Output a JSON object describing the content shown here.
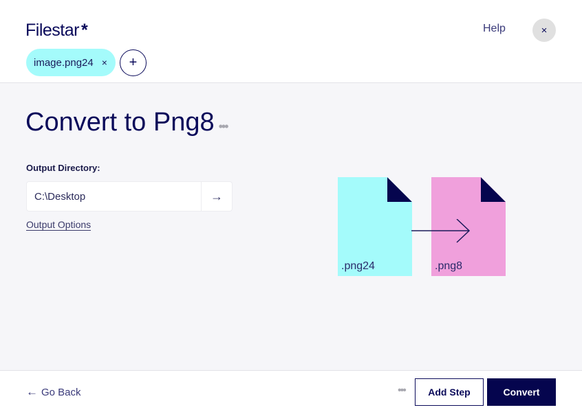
{
  "header": {
    "logo": "Filestar",
    "logo_mark": "*",
    "help_label": "Help",
    "close_icon": "×",
    "file_chip": {
      "label": "image.png24",
      "remove_icon": "×"
    },
    "add_file_icon": "+"
  },
  "main": {
    "title": "Convert to Png8",
    "title_menu_icon": "•••",
    "output_directory_label": "Output Directory:",
    "output_directory_value": "C:\\Desktop",
    "go_icon": "→",
    "output_options_label": "Output Options",
    "illustration": {
      "source_ext": ".png24",
      "target_ext": ".png8",
      "source_color": "#a4fbfb",
      "target_color": "#f0a0dc",
      "fold_color": "#05054e"
    }
  },
  "footer": {
    "back_icon": "←",
    "back_label": "Go Back",
    "more_icon": "•••",
    "add_step_label": "Add Step",
    "convert_label": "Convert"
  }
}
